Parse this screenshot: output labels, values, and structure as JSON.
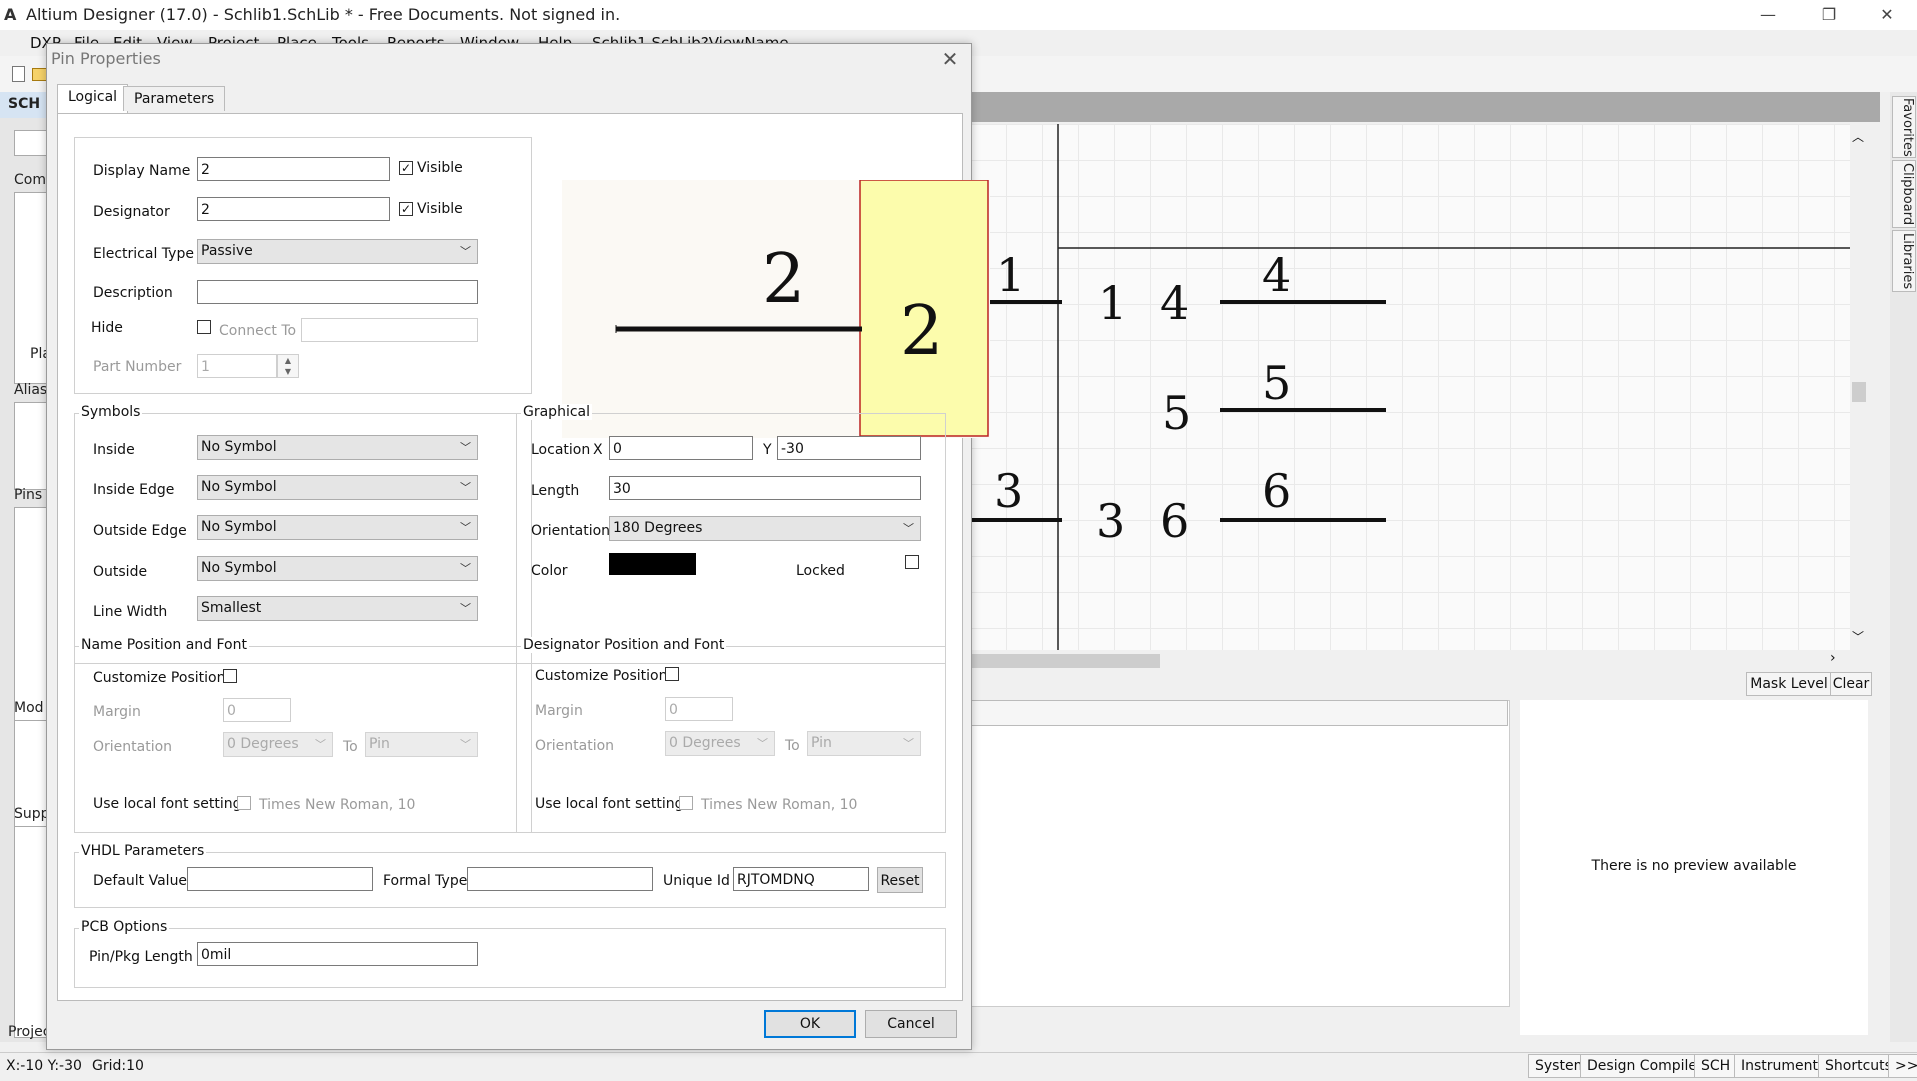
{
  "app": {
    "title": "Altium Designer (17.0) - Schlib1.SchLib * - Free Documents. Not signed in.",
    "minimize": "—",
    "restore": "❐",
    "close": "✕"
  },
  "menu": {
    "items": [
      "DXP",
      "File",
      "Edit",
      "View",
      "Project",
      "Place",
      "Tools",
      "Reports",
      "Window",
      "Help",
      "Schlib1.SchLib?ViewName"
    ]
  },
  "left_panel": {
    "title": "SCH L",
    "labels": [
      "Com",
      "Pla",
      "Alias",
      "Pins",
      "Mod",
      "Supp",
      "Projec"
    ]
  },
  "right_tabs": [
    "Favorites",
    "Clipboard",
    "Libraries"
  ],
  "editor": {
    "pin_labels": [
      "1",
      "1",
      "4",
      "4",
      "5",
      "5",
      "3",
      "3",
      "6",
      "6"
    ]
  },
  "mask_level": "Mask Level",
  "clear": "Clear",
  "preview_message": "There is no preview available",
  "status": {
    "coords": "X:-10 Y:-30",
    "grid": "Grid:10",
    "buttons": [
      "System",
      "Design Compiler",
      "SCH",
      "Instruments",
      "Shortcuts",
      ">>"
    ]
  },
  "dialog": {
    "title": "Pin Properties",
    "close": "✕",
    "tabs": [
      "Logical",
      "Parameters"
    ],
    "display_name_label": "Display Name",
    "display_name": "2",
    "display_name_visible": true,
    "designator_label": "Designator",
    "designator": "2",
    "designator_visible": true,
    "visible_label": "Visible",
    "electrical_type_label": "Electrical Type",
    "electrical_type": "Passive",
    "description_label": "Description",
    "description": "",
    "hide_label": "Hide",
    "hide": false,
    "connect_to_label": "Connect To",
    "part_number_label": "Part Number",
    "part_number": "1",
    "preview": {
      "name": "2",
      "designator": "2"
    },
    "symbols": {
      "title": "Symbols",
      "inside_label": "Inside",
      "inside": "No Symbol",
      "inside_edge_label": "Inside Edge",
      "inside_edge": "No Symbol",
      "outside_edge_label": "Outside Edge",
      "outside_edge": "No Symbol",
      "outside_label": "Outside",
      "outside": "No Symbol",
      "line_width_label": "Line Width",
      "line_width": "Smallest"
    },
    "graphical": {
      "title": "Graphical",
      "location_label": "Location",
      "x_label": "X",
      "x": "0",
      "y_label": "Y",
      "y": "-30",
      "length_label": "Length",
      "length": "30",
      "orientation_label": "Orientation",
      "orientation": "180 Degrees",
      "color_label": "Color",
      "color": "#000000",
      "locked_label": "Locked",
      "locked": false
    },
    "name_pos": {
      "title": "Name Position and Font",
      "customize_label": "Customize Position",
      "margin_label": "Margin",
      "margin": "0",
      "orientation_label": "Orientation",
      "orientation": "0 Degrees",
      "to_label": "To",
      "to": "Pin",
      "font_label": "Use local font setting",
      "font": "Times New Roman, 10"
    },
    "des_pos": {
      "title": "Designator Position and Font",
      "customize_label": "Customize Position",
      "margin_label": "Margin",
      "margin": "0",
      "orientation_label": "Orientation",
      "orientation": "0 Degrees",
      "to_label": "To",
      "to": "Pin",
      "font_label": "Use local font setting",
      "font": "Times New Roman, 10"
    },
    "vhdl": {
      "title": "VHDL Parameters",
      "default_value_label": "Default Value",
      "default_value": "",
      "formal_type_label": "Formal Type",
      "formal_type": "",
      "unique_id_label": "Unique Id",
      "unique_id": "RJTOMDNQ",
      "reset": "Reset"
    },
    "pcb": {
      "title": "PCB Options",
      "pin_pkg_length_label": "Pin/Pkg Length",
      "pin_pkg_length": "0mil"
    },
    "ok": "OK",
    "cancel": "Cancel"
  }
}
